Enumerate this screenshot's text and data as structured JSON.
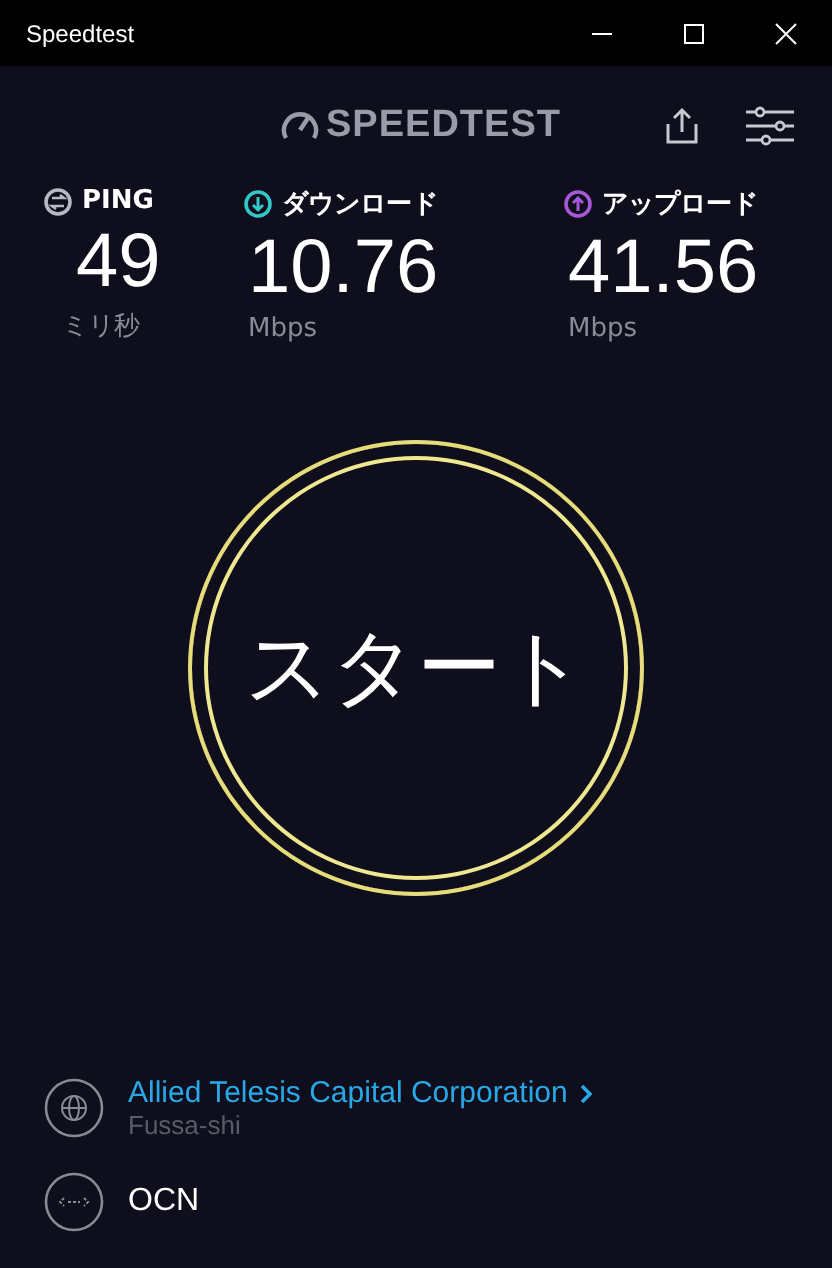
{
  "window": {
    "title": "Speedtest"
  },
  "header": {
    "logo": "SPEEDTEST"
  },
  "metrics": [
    {
      "kind": "ping",
      "label": "PING",
      "value": "49",
      "unit": "ミリ秒",
      "color": "#b8b8c0"
    },
    {
      "kind": "download",
      "label": "ダウンロード",
      "value": "10.76",
      "unit": "Mbps",
      "color": "#34c6c6"
    },
    {
      "kind": "upload",
      "label": "アップロード",
      "value": "41.56",
      "unit": "Mbps",
      "color": "#a659d6"
    }
  ],
  "start_button": {
    "label": "スタート"
  },
  "server": {
    "name": "Allied Telesis Capital Corporation",
    "location": "Fussa-shi"
  },
  "isp": {
    "name": "OCN"
  }
}
